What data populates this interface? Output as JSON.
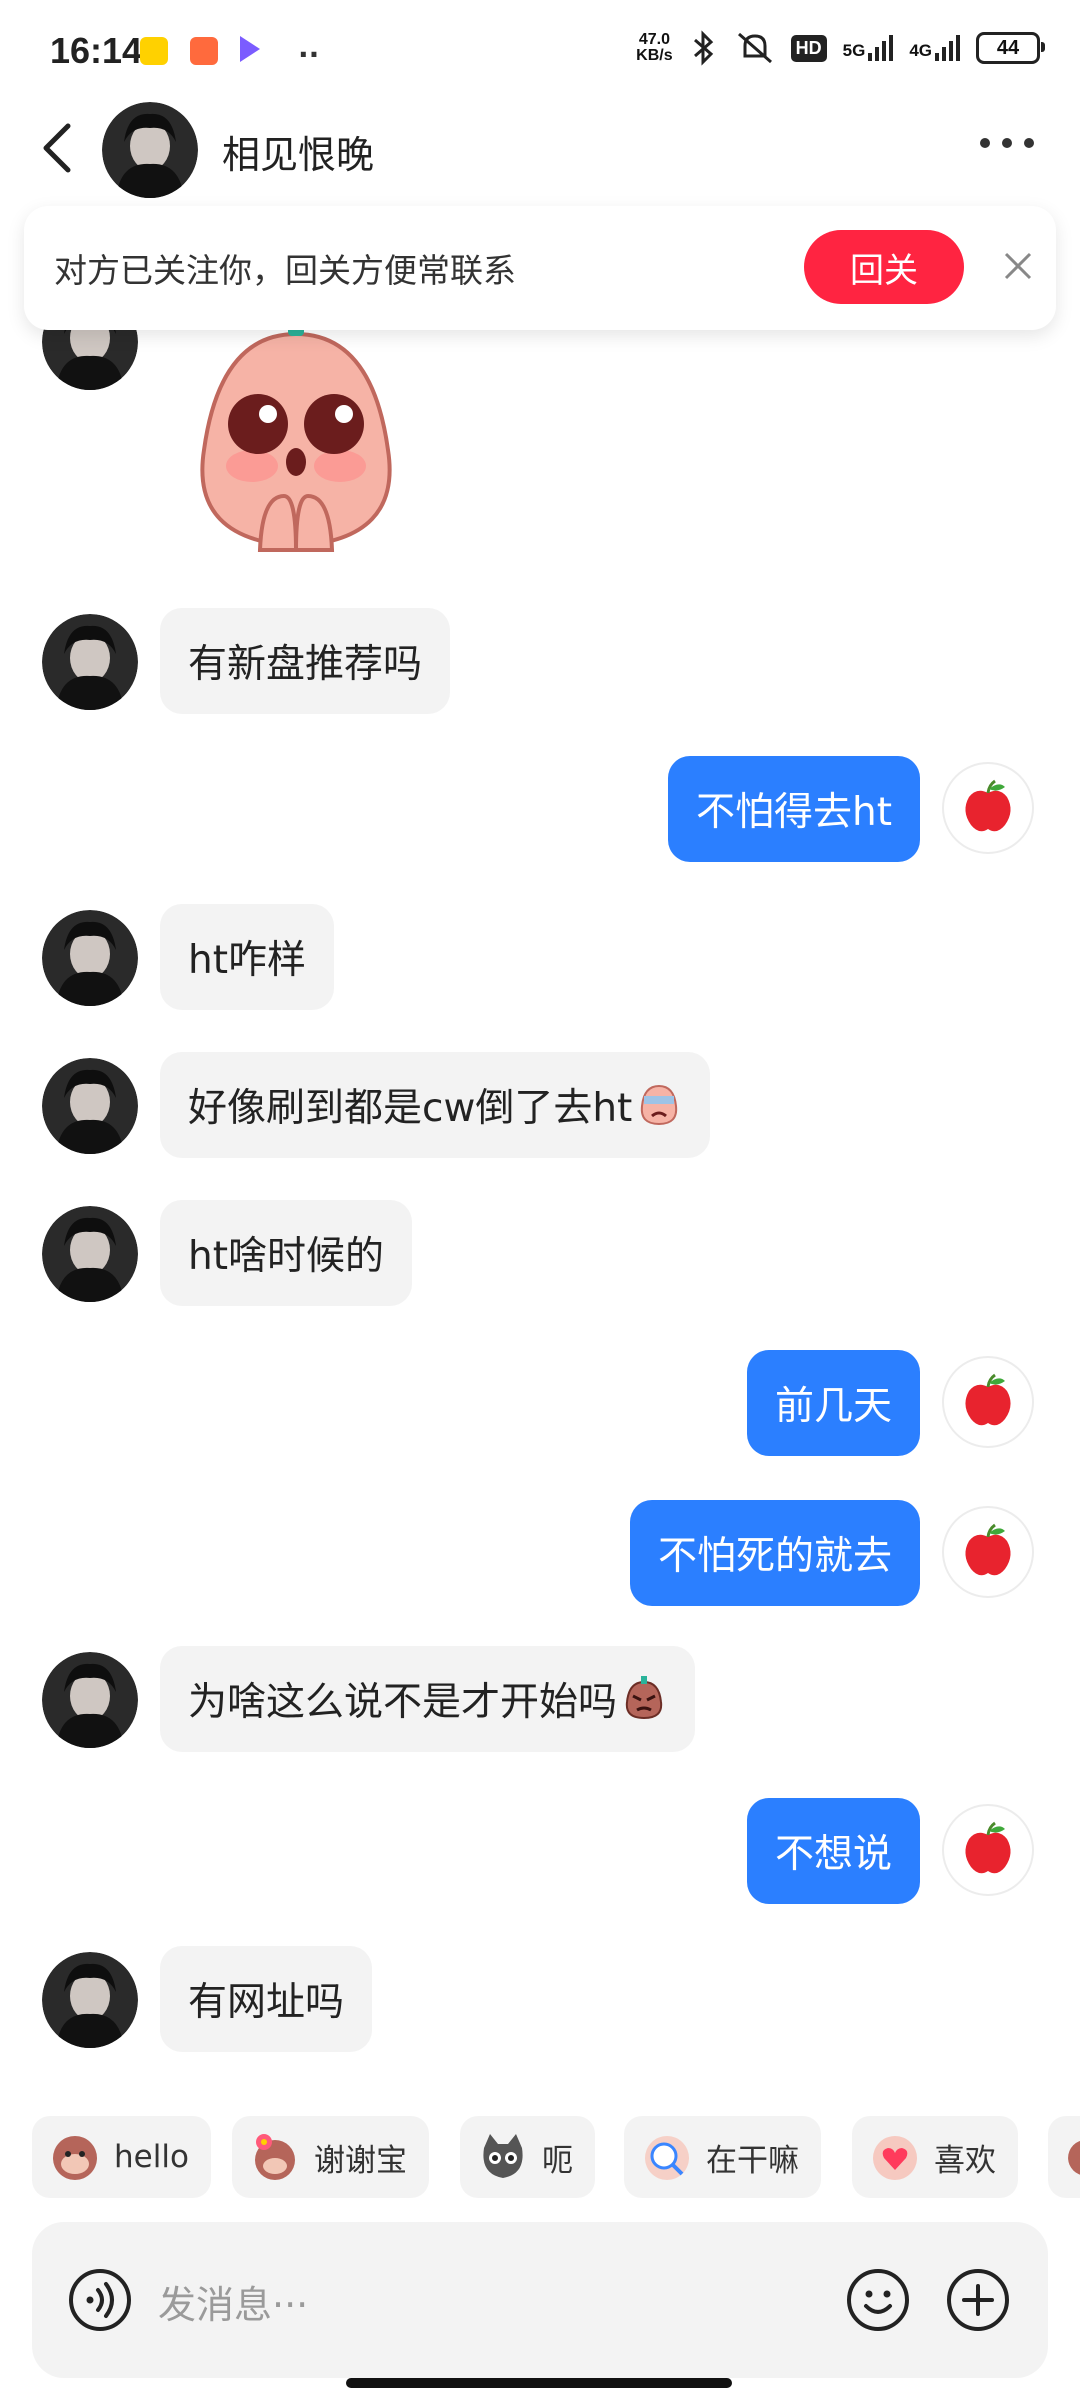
{
  "status": {
    "time": "16:14",
    "net_speed_top": "47.0",
    "net_speed_bottom": "KB/s",
    "hd": "HD",
    "sig1": "5G",
    "sig2": "4G",
    "battery": "44"
  },
  "header": {
    "name": "相见恨晚"
  },
  "banner": {
    "text": "对方已关注你，回关方便常联系",
    "button": "回关"
  },
  "messages": [
    {
      "text": "有新盘推荐吗"
    },
    {
      "text": "不怕得去ht"
    },
    {
      "text": "ht咋样"
    },
    {
      "text": "好像刷到都是cw倒了去ht"
    },
    {
      "text": "ht啥时候的"
    },
    {
      "text": "前几天"
    },
    {
      "text": "不怕死的就去"
    },
    {
      "text": "为啥这么说不是才开始吗"
    },
    {
      "text": "不想说"
    },
    {
      "text": "有网址吗"
    }
  ],
  "quick": [
    {
      "label": "hello"
    },
    {
      "label": "谢谢宝"
    },
    {
      "label": "呃"
    },
    {
      "label": "在干嘛"
    },
    {
      "label": "喜欢"
    }
  ],
  "input": {
    "placeholder": "发消息···"
  },
  "colors": {
    "accent_red": "#ff2441",
    "bubble_out": "#2b7fff",
    "bubble_in": "#f3f3f3"
  }
}
